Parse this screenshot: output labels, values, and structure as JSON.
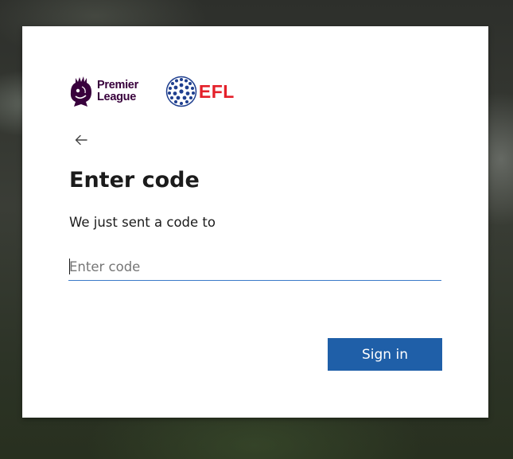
{
  "branding": {
    "premier_league_text": "Premier\nLeague",
    "efl_text": "EFL",
    "premier_league_color": "#38003c",
    "efl_color": "#e4202a"
  },
  "nav": {
    "back_icon": "arrow-left-icon"
  },
  "content": {
    "title": "Enter code",
    "description": "We just sent a code to"
  },
  "form": {
    "code_placeholder": "Enter code",
    "code_value": ""
  },
  "actions": {
    "sign_in_label": "Sign in",
    "accent_color": "#1f5fa8"
  }
}
